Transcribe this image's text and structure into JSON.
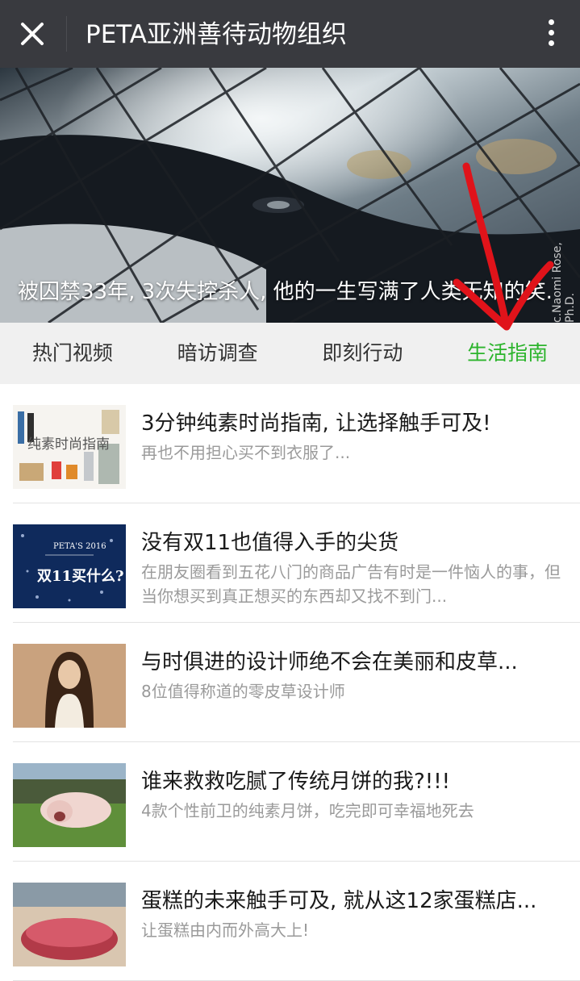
{
  "header": {
    "title": "PETA亚洲善待动物组织",
    "close_icon": "close-icon",
    "more_icon": "more-vertical-icon",
    "background": "#393a3f"
  },
  "banner": {
    "caption": "被囚禁33年, 3次失控杀人, 他的一生写满了人类无知的笑.",
    "credit": "c.Naomi Rose, Ph.D."
  },
  "tabs": [
    {
      "label": "热门视频",
      "active": false
    },
    {
      "label": "暗访调查",
      "active": false
    },
    {
      "label": "即刻行动",
      "active": false
    },
    {
      "label": "生活指南",
      "active": true
    }
  ],
  "accent_color": "#2cb42c",
  "articles": [
    {
      "title": "3分钟纯素时尚指南, 让选择触手可及!",
      "desc": "再也不用担心买不到衣服了...",
      "thumb_text": "纯素时尚指南"
    },
    {
      "title": "没有双11也值得入手的尖货",
      "desc": "在朋友圈看到五花八门的商品广告有时是一件恼人的事，但当你想买到真正想买的东西却又找不到门...",
      "thumb_text": "双11买什么?",
      "thumb_small": "PETA'S 2016"
    },
    {
      "title": "与时俱进的设计师绝不会在美丽和皮草...",
      "desc": "8位值得称道的零皮草设计师"
    },
    {
      "title": "谁来救救吃腻了传统月饼的我?!!!",
      "desc": "4款个性前卫的纯素月饼，吃完即可幸福地死去"
    },
    {
      "title": "蛋糕的未来触手可及, 就从这12家蛋糕店...",
      "desc": "让蛋糕由内而外高大上!"
    }
  ]
}
